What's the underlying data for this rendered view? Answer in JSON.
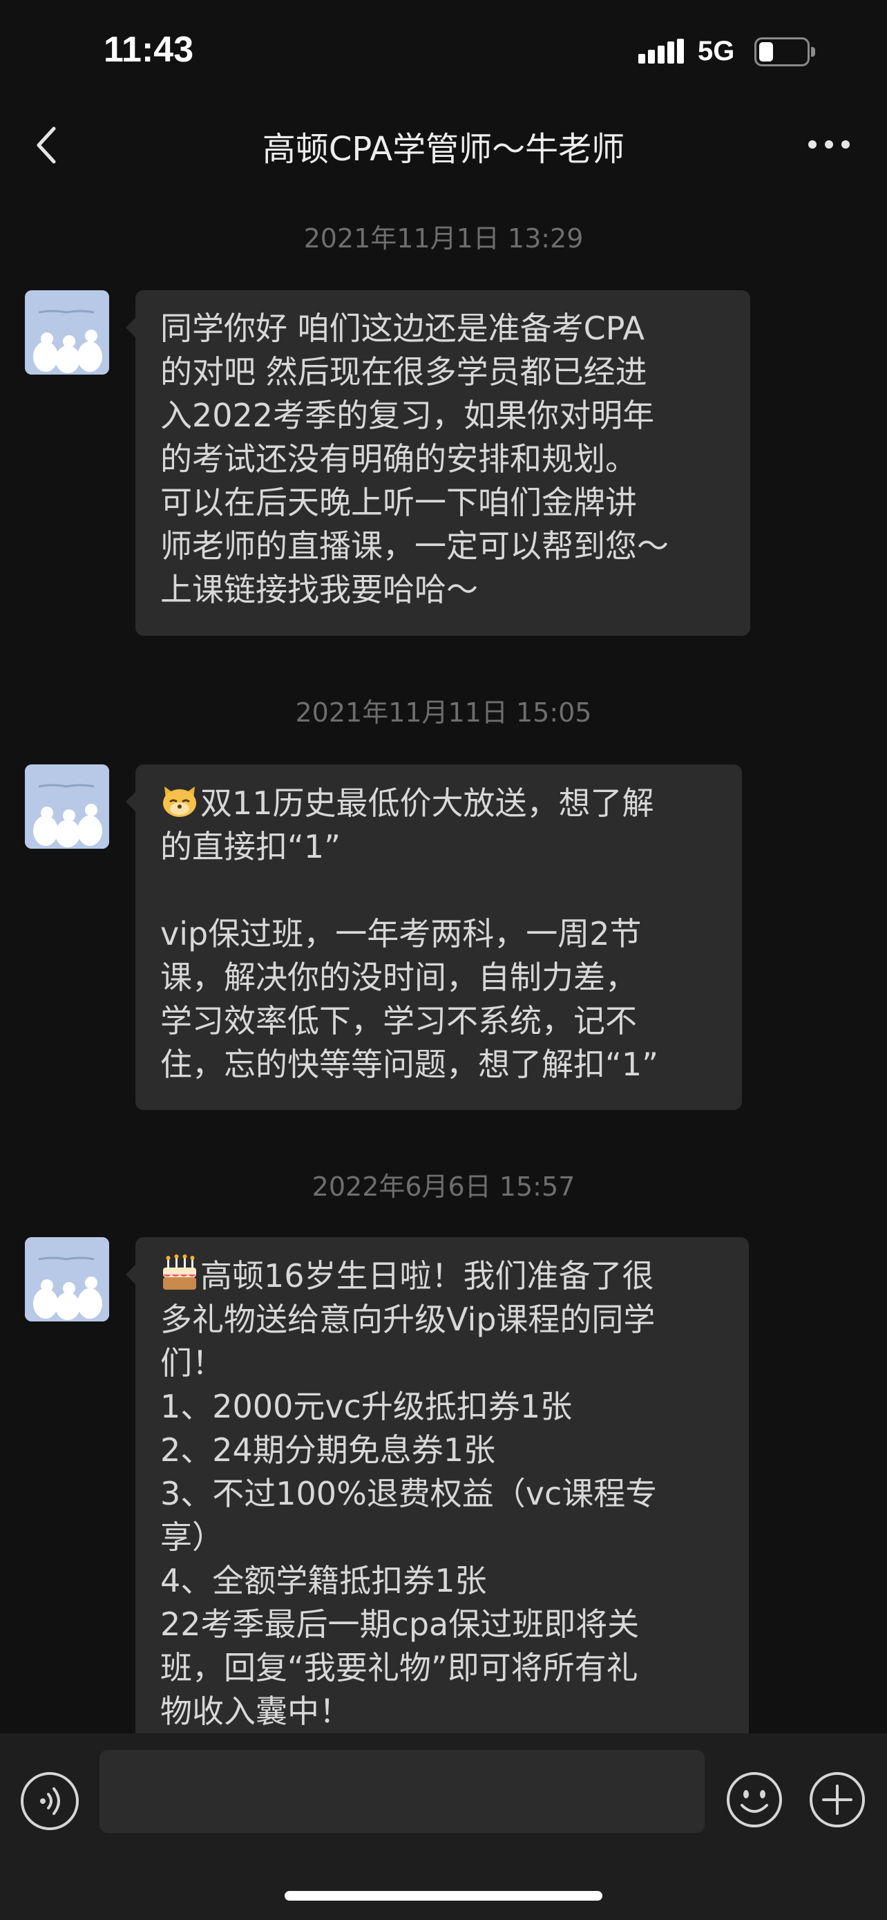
{
  "status_bar": {
    "time": "11:43",
    "network": "5G",
    "battery_level": 0.2,
    "icons": [
      "signal-icon",
      "battery-icon"
    ]
  },
  "nav": {
    "title": "高顿CPA学管师～牛老师",
    "icons": [
      "back-icon",
      "more-icon"
    ]
  },
  "messages": [
    {
      "timestamp": "2021年11月1日 13:29",
      "lines": [
        "同学你好 咱们这边还是准备考CPA",
        "的对吧 然后现在很多学员都已经进",
        "入2022考季的复习，如果你对明年",
        "的考试还没有明确的安排和规划。",
        "可以在后天晚上听一下咱们金牌讲",
        "师老师的直播课，一定可以帮到您～",
        "上课链接找我要哈哈～"
      ]
    },
    {
      "timestamp": "2021年11月11日 15:05",
      "emoji": "cat-emoji",
      "lines": [
        "双11历史最低价大放送，想了解",
        "的直接扣“1”",
        "",
        "vip保过班，一年考两科，一周2节",
        "课，解决你的没时间，自制力差，",
        "学习效率低下，学习不系统，记不",
        "住，忘的快等等问题，想了解扣“1”"
      ]
    },
    {
      "timestamp": "2022年6月6日 15:57",
      "emoji": "cake-emoji",
      "lines": [
        "高顿16岁生日啦！我们准备了很",
        "多礼物送给意向升级Vip课程的同学",
        "们！",
        "1、2000元vc升级抵扣券1张",
        "2、24期分期免息券1张",
        "3、不过100%退费权益（vc课程专",
        "享）",
        "4、全额学籍抵扣券1张",
        "22考季最后一期cpa保过班即将关",
        "班，回复“我要礼物”即可将所有礼",
        "物收入囊中！"
      ]
    }
  ],
  "input_bar": {
    "placeholder": "",
    "icons": [
      "voice-icon",
      "emoji-icon",
      "plus-icon"
    ]
  },
  "colors": {
    "background": "#111111",
    "bubble": "#2c2c2c",
    "input_bar": "#1e1e1e",
    "timestamp": "#6e6e6e"
  }
}
